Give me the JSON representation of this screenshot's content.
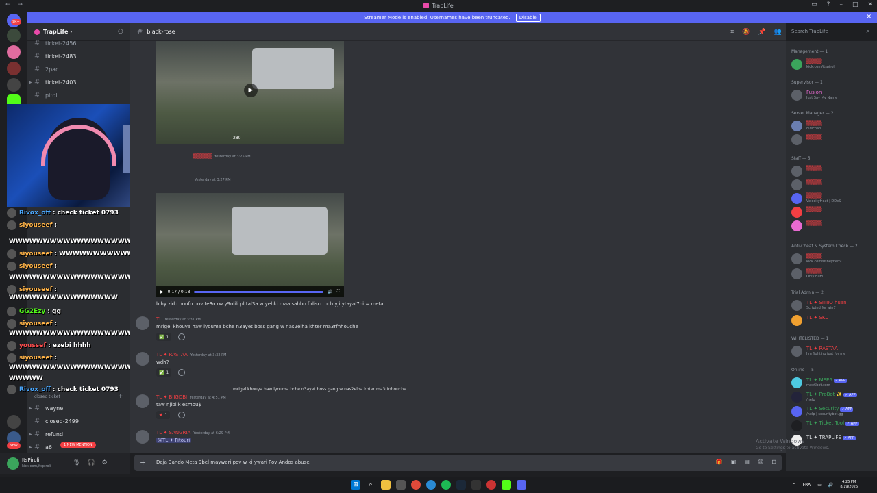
{
  "window": {
    "title": "TrapLife"
  },
  "banner": {
    "text": "Streamer Mode is enabled. Usernames have been truncated.",
    "disable_label": "Disable"
  },
  "rail": {
    "notification_badge": "9K+"
  },
  "server": {
    "name": "TrapLife"
  },
  "channels": [
    {
      "name": "ticket-2456",
      "active": false,
      "collapsed": false
    },
    {
      "name": "ticket-2483",
      "active": true,
      "collapsed": false
    },
    {
      "name": "2pac",
      "active": false,
      "collapsed": false
    },
    {
      "name": "ticket-2403",
      "active": true,
      "collapsed": true
    },
    {
      "name": "piroli",
      "active": false,
      "collapsed": false
    }
  ],
  "channels_bottom": {
    "category": "closed ticket",
    "items": [
      {
        "name": "wayne",
        "active": true
      },
      {
        "name": "closed-2499",
        "active": true
      },
      {
        "name": "refund",
        "active": true
      },
      {
        "name": "a6",
        "active": true
      }
    ],
    "new_label": "NEW",
    "mention_label": "1 NEW MENTION"
  },
  "user": {
    "name": "ItsPiroli",
    "status": "kick.com/itspiroli"
  },
  "overlay_chat": [
    {
      "name": "Rivox_off",
      "msg": ": check ticket 0793",
      "color": "#4aa8ff"
    },
    {
      "name": "siyouseef",
      "msg": ":",
      "color": "#ffb347"
    },
    {
      "name": "",
      "msg": "WWWWWWWWWWWWWWWWWWWW",
      "color": "#ffffff"
    },
    {
      "name": "siyouseef",
      "msg": ": WWWWWWWWWWWWWW",
      "color": "#ffb347"
    },
    {
      "name": "siyouseef",
      "msg": ":",
      "color": "#ffb347"
    },
    {
      "name": "",
      "msg": "WWWWWWWWWWWWWWWWWWWW",
      "color": "#ffffff"
    },
    {
      "name": "siyouseef",
      "msg": ":",
      "color": "#ffb347"
    },
    {
      "name": "",
      "msg": "WWWWWWWWWWWWWWWW",
      "color": "#ffffff"
    },
    {
      "name": "GG2Ezy",
      "msg": ": gg",
      "color": "#53fc18"
    },
    {
      "name": "siyouseef",
      "msg": ":",
      "color": "#ffb347"
    },
    {
      "name": "",
      "msg": "WWWWWWWWWWWWWWWWWWWWW",
      "color": "#ffffff"
    },
    {
      "name": "youssef",
      "msg": ": ezebi hhhh",
      "color": "#ff4d4d"
    },
    {
      "name": "siyouseef",
      "msg": ":",
      "color": "#ffb347"
    },
    {
      "name": "",
      "msg": "WWWWWWWWWWWWWWWWWWWWWW",
      "color": "#ffffff"
    },
    {
      "name": "",
      "msg": "WWWWW",
      "color": "#ffffff"
    },
    {
      "name": "Rivox_off",
      "msg": ": check ticket 0793",
      "color": "#4aa8ff"
    }
  ],
  "channel": {
    "name": "black-rose"
  },
  "search": {
    "placeholder": "Search TrapLife"
  },
  "messages": {
    "video1_caption": "280",
    "msg1_time": "Yesterday at 3:25 PM",
    "msg2_time": "Yesterday at 3:27 PM",
    "video2_time": "0:17 / 0:18",
    "text1": "blhy zid choufo pov te3o rw y9olili pl tal3a w yehki maa sahbo f discc bch yji ytayai7ni = meta",
    "msg3_author": "TL",
    "msg3_time": "Yesterday at 3:31 PM",
    "msg3_text": "mrigel khouya haw lyouma bche n3ayet boss gang w nas2elha khter ma3rfnhouche",
    "msg3_react_count": "1",
    "msg4_author": "TL ✦ RASTAA",
    "msg4_time": "Yesterday at 3:32 PM",
    "msg4_text": "wdh?",
    "msg4_react_count": "1",
    "msg5_reply": "mrigel khouya haw lyouma bche n3ayet boss gang w nas2elha khter ma3rfnhouche",
    "msg5_author": "TL ✦ BIIGDBI",
    "msg5_time": "Yesterday at 4:51 PM",
    "msg5_text": "taw njiblik esmou$",
    "msg5_react_count": "1",
    "msg6_author": "TL ✦ SANGRIA",
    "msg6_time": "Yesterday at 6:29 PM",
    "msg6_mention": "@TL ✦ Fitouri"
  },
  "input": {
    "value": "Deja 3ando Meta 9bel maywari pov w ki ywari Pov Andos abuse"
  },
  "members": {
    "groups": [
      {
        "label": "Management — 1"
      },
      {
        "label": "Supervisor — 1"
      },
      {
        "label": "Server Manager — 2"
      },
      {
        "label": "Staff — 5"
      },
      {
        "label": "Anti-Cheat & System Check — 2"
      },
      {
        "label": "Trial Admin — 2"
      },
      {
        "label": "WHITELISTED — 1"
      },
      {
        "label": "Online — 5"
      }
    ],
    "management_sub": "kick.com/itspiroli",
    "supervisor_name": "Fusion",
    "supervisor_sub": "Just Say My Name",
    "sm1_sub": "didichan",
    "staff3_sub": "VelocityHeat | DDoS",
    "ac1_sub": "kick.com/dsheyneh9",
    "ac2_sub": "Only BuBu",
    "trial1_name": "TL ✦ SIIIIIO huan",
    "trial1_sub": "Scripted for win7",
    "trial2_name": "TL ✦ SKL",
    "wl_name": "TL ✦ RASTAA",
    "wl_sub": "I'm fighting just for me",
    "bots": [
      {
        "name": "TL ✦ MEE6",
        "sub": "mee6bot.com"
      },
      {
        "name": "TL ✦ ProBot ✨",
        "sub": "/help"
      },
      {
        "name": "TL ✦ Security",
        "sub": "/help | securitybot.gg"
      },
      {
        "name": "TL ✦ Ticket Tool",
        "sub": ""
      },
      {
        "name": "TL ✦ TRAPLIFE",
        "sub": ""
      }
    ],
    "app_badge": "✓ APP"
  },
  "activate": {
    "title": "Activate Windows",
    "sub": "Go to Settings to activate Windows."
  },
  "taskbar": {
    "lang": "FRA",
    "time": "4:25 PM",
    "date": "8/19/2026"
  }
}
